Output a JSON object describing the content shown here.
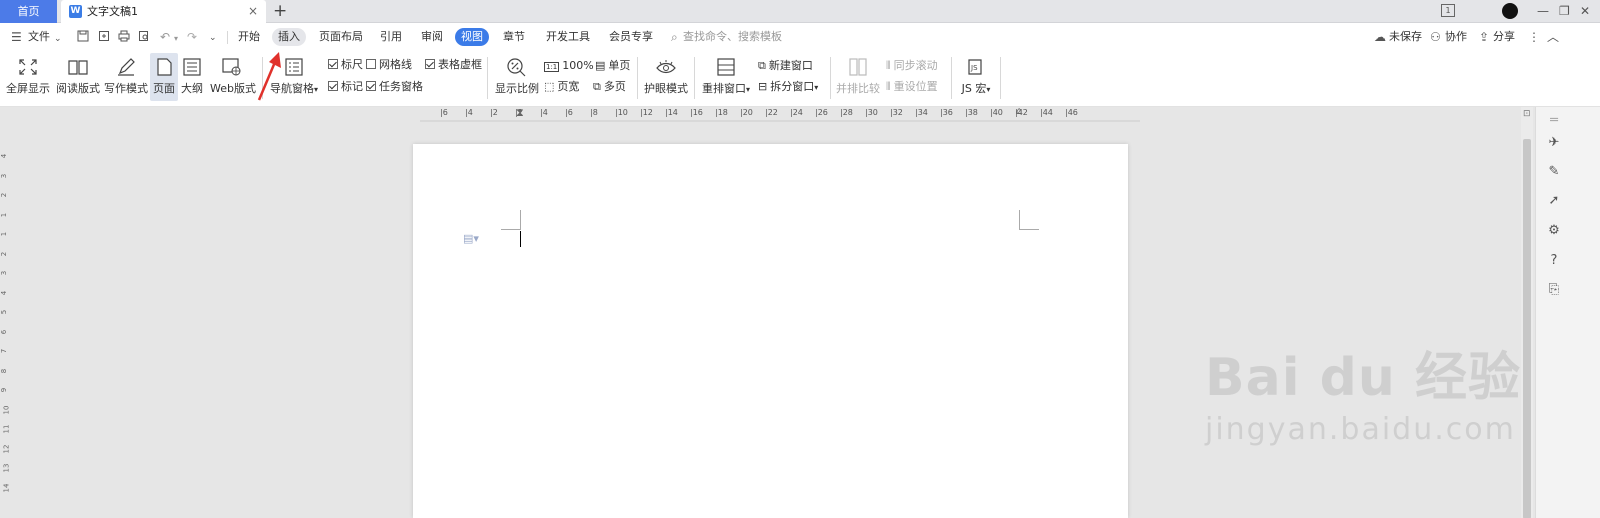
{
  "tabs": {
    "home": "首页",
    "doc_title": "文字文稿1",
    "doc_icon": "W",
    "close": "×",
    "new_tab": "+"
  },
  "window": {
    "badge": "1",
    "minimize": "—",
    "restore": "❐",
    "close": "✕"
  },
  "menu": {
    "file": "文件",
    "items": [
      "开始",
      "插入",
      "页面布局",
      "引用",
      "审阅",
      "视图",
      "章节",
      "开发工具",
      "会员专享"
    ],
    "active": "视图",
    "hovered": "插入",
    "search_placeholder": "查找命令、搜索模板",
    "unsaved": "未保存",
    "collaborate": "协作",
    "share": "分享"
  },
  "ribbon": {
    "fullscreen": "全屏显示",
    "reading": "阅读版式",
    "writing": "写作模式",
    "page": "页面",
    "outline": "大纲",
    "web": "Web版式",
    "nav_pane": "导航窗格",
    "ruler": "标尺",
    "gridlines": "网格线",
    "table_gridlines": "表格虚框",
    "marks": "标记",
    "task_pane": "任务窗格",
    "zoom": "显示比例",
    "zoom_100": "100%",
    "zoom_100_icon": "1:1",
    "page_width": "页宽",
    "single_page": "单页",
    "multi_page": "多页",
    "eye_mode": "护眼模式",
    "arrange_windows": "重排窗口",
    "new_window": "新建窗口",
    "split_window": "拆分窗口",
    "side_by_side": "并排比较",
    "sync_scroll": "同步滚动",
    "reset_position": "重设位置",
    "js_macro": "JS 宏"
  },
  "checkboxes": {
    "ruler": true,
    "gridlines": false,
    "table_gridlines": true,
    "marks": true,
    "task_pane": true
  },
  "ruler_labels": [
    "6",
    "4",
    "2",
    "2",
    "4",
    "6",
    "8",
    "10",
    "12",
    "14",
    "16",
    "18",
    "20",
    "22",
    "24",
    "26",
    "28",
    "30",
    "32",
    "34",
    "36",
    "38",
    "40",
    "42",
    "44",
    "46"
  ],
  "vruler_labels": [
    "4",
    "3",
    "2",
    "1",
    "1",
    "2",
    "3",
    "4",
    "5",
    "6",
    "7",
    "8",
    "9",
    "10",
    "11",
    "12",
    "13",
    "14"
  ],
  "watermark": {
    "main": "Bai du 经验",
    "sub": "jingyan.baidu.com"
  },
  "colors": {
    "accent": "#3b7be8",
    "home_tab": "#4c7be8",
    "arrow": "#e0312b"
  }
}
